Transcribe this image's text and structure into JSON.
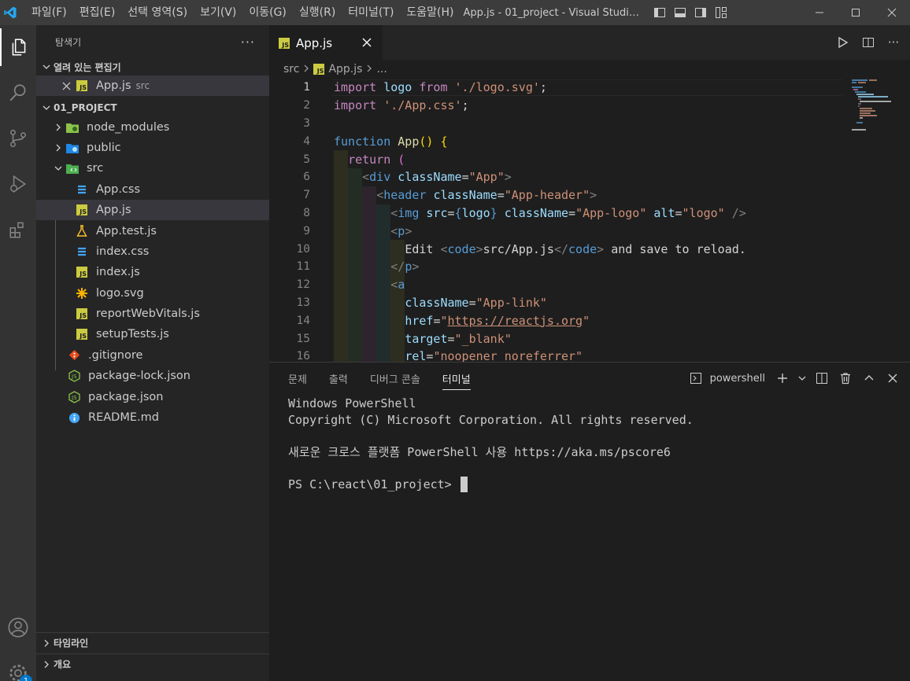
{
  "titlebar": {
    "menu": [
      "파일(F)",
      "편집(E)",
      "선택 영역(S)",
      "보기(V)",
      "이동(G)",
      "실행(R)",
      "터미널(T)",
      "도움말(H)"
    ],
    "window_title": "App.js - 01_project - Visual Studio Code"
  },
  "sidebar": {
    "title": "탐색기",
    "open_editors_label": "열려 있는 편집기",
    "open_editor": {
      "name": "App.js",
      "folder": "src"
    },
    "project_label": "01_PROJECT",
    "tree": [
      {
        "name": "node_modules",
        "kind": "folder",
        "icon": "node-folder-icon"
      },
      {
        "name": "public",
        "kind": "folder",
        "icon": "public-folder-icon"
      },
      {
        "name": "src",
        "kind": "folder-open",
        "icon": "src-folder-icon"
      },
      {
        "name": "App.css",
        "kind": "file",
        "icon": "css-icon"
      },
      {
        "name": "App.js",
        "kind": "file",
        "icon": "js-icon"
      },
      {
        "name": "App.test.js",
        "kind": "file",
        "icon": "test-flask-icon"
      },
      {
        "name": "index.css",
        "kind": "file",
        "icon": "css-icon"
      },
      {
        "name": "index.js",
        "kind": "file",
        "icon": "js-icon"
      },
      {
        "name": "logo.svg",
        "kind": "file",
        "icon": "svg-icon"
      },
      {
        "name": "reportWebVitals.js",
        "kind": "file",
        "icon": "js-icon"
      },
      {
        "name": "setupTests.js",
        "kind": "file",
        "icon": "js-icon"
      },
      {
        "name": ".gitignore",
        "kind": "file",
        "icon": "git-icon"
      },
      {
        "name": "package-lock.json",
        "kind": "file",
        "icon": "node-json-icon"
      },
      {
        "name": "package.json",
        "kind": "file",
        "icon": "node-json-icon"
      },
      {
        "name": "README.md",
        "kind": "file",
        "icon": "info-icon"
      }
    ],
    "timeline_label": "타임라인",
    "outline_label": "개요"
  },
  "editor": {
    "tab_label": "App.js",
    "breadcrumb": [
      "src",
      "App.js",
      "..."
    ],
    "line_numbers": [
      "1",
      "2",
      "3",
      "4",
      "5",
      "6",
      "7",
      "8",
      "9",
      "10",
      "11",
      "12",
      "13",
      "14",
      "15",
      "16"
    ],
    "lines": [
      "import logo from './logo.svg';",
      "import './App.css';",
      "",
      "function App() {",
      "  return (",
      "    <div className=\"App\">",
      "      <header className=\"App-header\">",
      "        <img src={logo} className=\"App-logo\" alt=\"logo\" />",
      "        <p>",
      "          Edit <code>src/App.js</code> and save to reload.",
      "        </p>",
      "        <a",
      "          className=\"App-link\"",
      "          href=\"https://reactjs.org\"",
      "          target=\"_blank\"",
      "          rel=\"noopener noreferrer\""
    ]
  },
  "panel": {
    "tabs": [
      "문제",
      "출력",
      "디버그 콘솔",
      "터미널"
    ],
    "active_tab": "터미널",
    "shell_label": "powershell",
    "terminal_lines": [
      "Windows PowerShell",
      "Copyright (C) Microsoft Corporation. All rights reserved.",
      "",
      "새로운 크로스 플랫폼 PowerShell 사용 https://aka.ms/pscore6",
      "",
      "PS C:\\react\\01_project> "
    ]
  },
  "status": {
    "accounts_badge": "1"
  },
  "colors": {
    "accent_js": "#cbcb41",
    "keyword": "#569cd6",
    "string": "#ce9178",
    "function": "#dcdcaa",
    "attribute": "#9cdcfe"
  }
}
